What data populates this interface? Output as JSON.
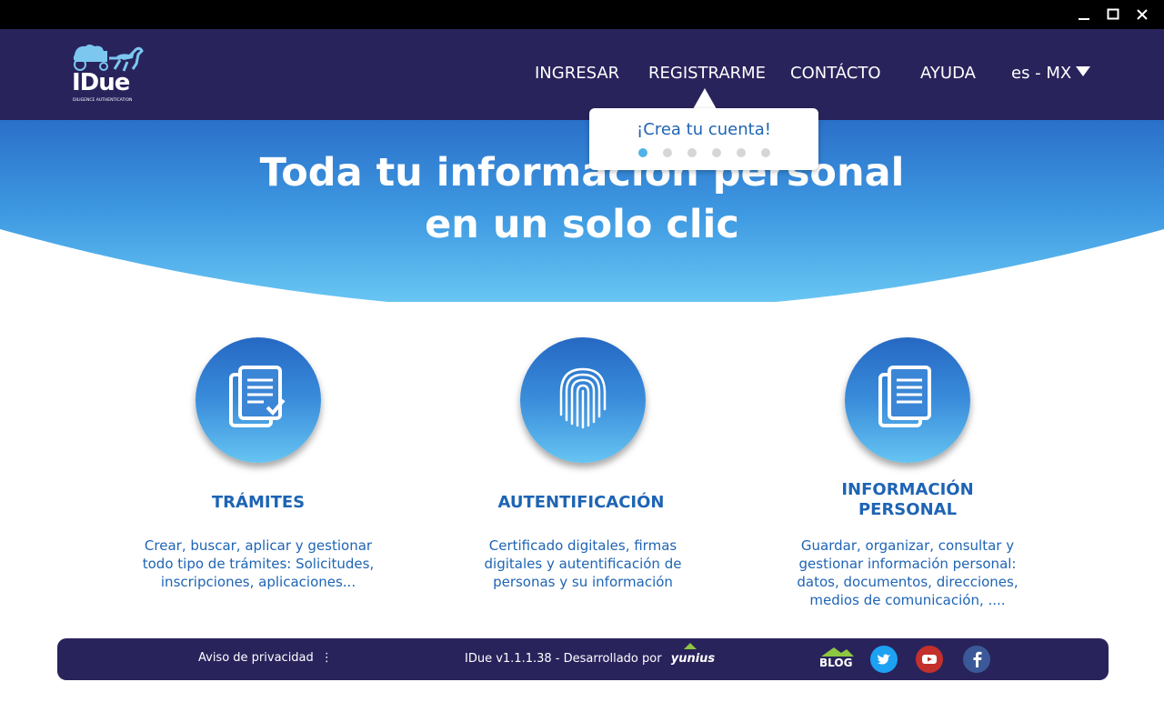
{
  "window": {
    "minimize_icon": "minimize-icon",
    "maximize_icon": "maximize-icon",
    "close_icon": "close-icon"
  },
  "brand": {
    "name": "IDue",
    "tagline": "DILIGENCE AUTHENTICATION",
    "logo_icon": "carriage-horse-logo"
  },
  "nav": {
    "items": [
      "INGRESAR",
      "REGISTRARME",
      "CONTÁCTO",
      "AYUDA"
    ],
    "language": "es - MX"
  },
  "tooltip": {
    "text": "¡Crea tu cuenta!",
    "dot_count": 6,
    "active_dot": 0
  },
  "hero": {
    "line1": "Toda tu información personal",
    "line2": "en un solo clic"
  },
  "features": [
    {
      "title": "TRÁMITES",
      "desc": [
        "Crear, buscar, aplicar y gestionar",
        "todo tipo de trámites: Solicitudes,",
        "inscripciones, aplicaciones..."
      ],
      "icon": "documents-check-icon"
    },
    {
      "title": "AUTENTIFICACIÓN",
      "desc": [
        "Certificado digitales, firmas",
        "digitales y autentificación de",
        "personas y su información"
      ],
      "icon": "fingerprint-icon"
    },
    {
      "title_lines": [
        "INFORMACIÓN",
        "PERSONAL"
      ],
      "desc": [
        "Guardar, organizar, consultar y",
        "gestionar información personal:",
        "datos, documentos, direcciones,",
        "medios de comunicación, ...."
      ],
      "icon": "documents-icon"
    }
  ],
  "footer": {
    "privacy": "Aviso de privacidad",
    "version": "IDue v1.1.1.38 - Desarrollado por",
    "developer": "yunius",
    "blog": "BLOG"
  },
  "colors": {
    "navy": "#29235c",
    "blue": "#1e64b4",
    "light_blue": "#66c4f2",
    "twitter": "#1da1f2",
    "youtube": "#c4302b",
    "facebook": "#3b5998"
  }
}
